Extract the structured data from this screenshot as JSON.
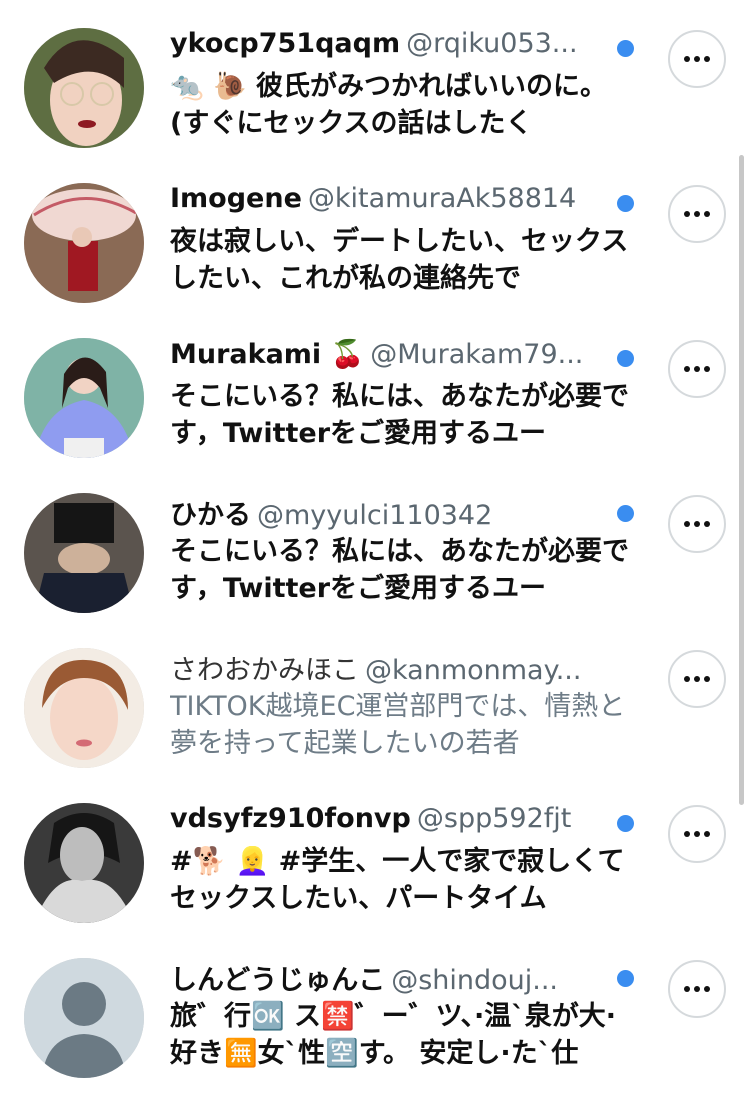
{
  "users": [
    {
      "name": "ykocp751qaqm",
      "handle": "@rqiku053...",
      "bio": "🐀 🐌 彼氏がみつかればいいのに。 (すぐにセックスの話はしたく",
      "followed": true,
      "muted": false,
      "avatar": "avatar-woman-glasses"
    },
    {
      "name": "Imogene",
      "handle": "@kitamuraAk58814",
      "bio": "夜は寂しい、デートしたい、セックスしたい、これが私の連絡先で",
      "followed": true,
      "muted": false,
      "avatar": "avatar-woman-parasol"
    },
    {
      "name": "Murakami 🍒",
      "handle": "@Murakam79...",
      "bio": "そこにいる？私には、あなたが必要です，Twitterをご愛用するユー",
      "followed": true,
      "muted": false,
      "avatar": "avatar-woman-purple-top"
    },
    {
      "name": "ひかる",
      "handle": "@myyulci110342",
      "bio": "そこにいる？私には、あなたが必要です，Twitterをご愛用するユー",
      "followed": true,
      "muted": false,
      "avatar": "avatar-woman-dark"
    },
    {
      "name": "さわおかみほこ",
      "handle": "@kanmonmay...",
      "bio": "TIKTOK越境EC運営部門では、情熱と夢を持って起業したいの若者",
      "followed": false,
      "muted": true,
      "avatar": "avatar-woman-short-hair"
    },
    {
      "name": "vdsyfz910fonvp",
      "handle": "@spp592fjt",
      "bio": "#🐕 👱‍♀️ #学生、一人で家で寂しくてセックスしたい、パートタイム",
      "followed": true,
      "muted": false,
      "avatar": "avatar-bw-portrait"
    },
    {
      "name": "しんどうじゅんこ",
      "handle": "@shindouj...",
      "bio": "旅゛行🆗 ス🈲゛ー゛ツ、·温`泉が大·好き🈚女`性🈳す。 安定し·た`仕",
      "followed": true,
      "muted": false,
      "avatar": "avatar-default-placeholder"
    }
  ],
  "colors": {
    "dot": "#3a8df0",
    "text": "#111111",
    "handle": "#5b6770",
    "muted": "#6e7c87"
  },
  "more_icon": "more-dots-icon"
}
